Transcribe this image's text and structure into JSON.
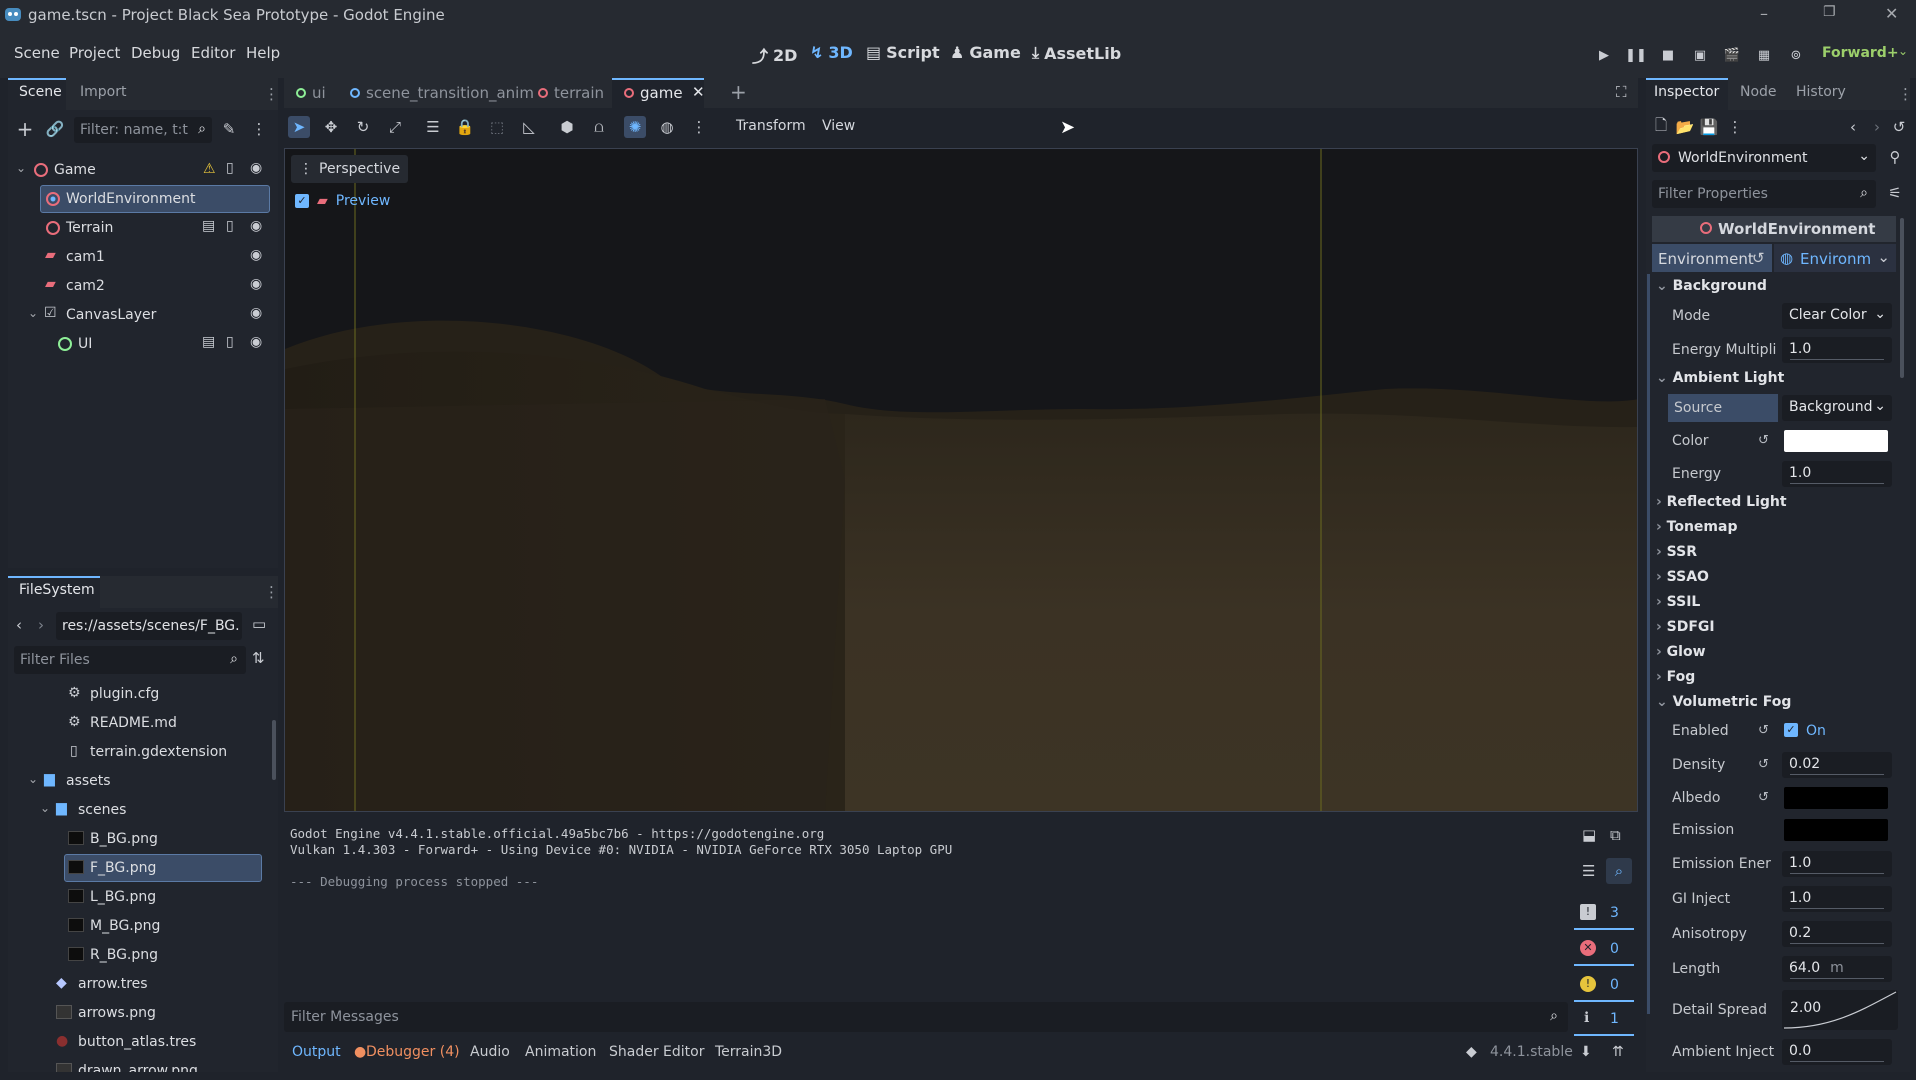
{
  "window": {
    "title": "game.tscn - Project Black Sea Prototype - Godot Engine"
  },
  "menu": [
    "Scene",
    "Project",
    "Debug",
    "Editor",
    "Help"
  ],
  "modes": {
    "m2d": "2D",
    "m3d": "3D",
    "script": "Script",
    "game": "Game",
    "assetlib": "AssetLib"
  },
  "renderer": "Forward+",
  "scene_dock": {
    "tabs": [
      "Scene",
      "Import"
    ],
    "filter_placeholder": "Filter: name, t:t",
    "nodes": [
      "Game",
      "WorldEnvironment",
      "Terrain",
      "cam1",
      "cam2",
      "CanvasLayer",
      "UI"
    ]
  },
  "filesystem": {
    "tab": "FileSystem",
    "path": "res://assets/scenes/F_BG.",
    "filter_placeholder": "Filter Files",
    "files": [
      "plugin.cfg",
      "README.md",
      "terrain.gdextension",
      "assets",
      "scenes",
      "B_BG.png",
      "F_BG.png",
      "L_BG.png",
      "M_BG.png",
      "R_BG.png",
      "arrow.tres",
      "arrows.png",
      "button_atlas.tres",
      "drawn_arrow.png"
    ]
  },
  "editor_tabs": [
    "ui",
    "scene_transition_anim",
    "terrain",
    "game"
  ],
  "viewport": {
    "toolbar": {
      "transform": "Transform",
      "view": "View"
    },
    "perspective": "Perspective",
    "preview": "Preview"
  },
  "inspector": {
    "tabs": [
      "Inspector",
      "Node",
      "History"
    ],
    "object": "WorldEnvironment",
    "filter_placeholder": "Filter Properties",
    "header": "WorldEnvironment",
    "env_label": "Environment",
    "env_value": "Environm",
    "sections": {
      "background": "Background",
      "ambient": "Ambient Light",
      "reflected": "Reflected Light",
      "tonemap": "Tonemap",
      "ssr": "SSR",
      "ssao": "SSAO",
      "ssil": "SSIL",
      "sdfgi": "SDFGI",
      "glow": "Glow",
      "fog": "Fog",
      "vfog": "Volumetric Fog"
    },
    "props": {
      "mode_k": "Mode",
      "mode_v": "Clear Color",
      "energy_mult_k": "Energy Multipli",
      "energy_mult_v": "1.0",
      "source_k": "Source",
      "source_v": "Background",
      "color_k": "Color",
      "energy_k": "Energy",
      "energy_v": "1.0",
      "enabled_k": "Enabled",
      "enabled_v": "On",
      "density_k": "Density",
      "density_v": "0.02",
      "albedo_k": "Albedo",
      "emission_k": "Emission",
      "emission_e_k": "Emission Ener",
      "emission_e_v": "1.0",
      "gi_k": "GI Inject",
      "gi_v": "1.0",
      "aniso_k": "Anisotropy",
      "aniso_v": "0.2",
      "length_k": "Length",
      "length_v": "64.0",
      "length_unit": "m",
      "detail_k": "Detail Spread",
      "detail_v": "2.00",
      "ambient_inj_k": "Ambient Inject",
      "ambient_inj_v": "0.0"
    },
    "colors": {
      "ambient_color": "#ffffff",
      "albedo": "#000000",
      "emission": "#000000"
    }
  },
  "output": {
    "lines": [
      "Godot Engine v4.4.1.stable.official.49a5bc7b6 - https://godotengine.org",
      "Vulkan 1.4.303 - Forward+ - Using Device #0: NVIDIA - NVIDIA GeForce RTX 3050 Laptop GPU",
      "",
      "--- Debugging process stopped ---"
    ],
    "filter_placeholder": "Filter Messages",
    "counts": {
      "messages": "3",
      "errors": "0",
      "warnings": "0",
      "editor": "1"
    }
  },
  "bottom_tabs": {
    "output": "Output",
    "debugger": "Debugger (4)",
    "audio": "Audio",
    "animation": "Animation",
    "shader": "Shader Editor",
    "terrain3d": "Terrain3D"
  },
  "version": "4.4.1.stable"
}
